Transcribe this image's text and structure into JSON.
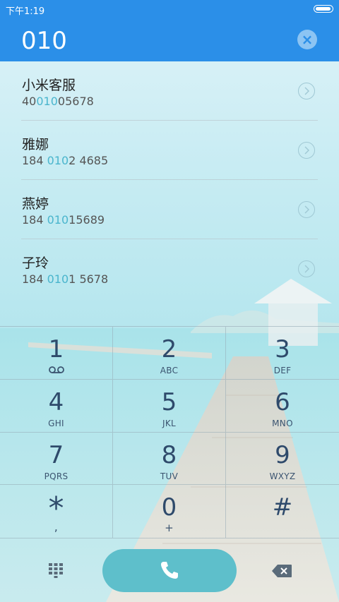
{
  "status_bar": {
    "time": "下午1:19",
    "battery_level": 0.95
  },
  "header": {
    "dialed_number": "010",
    "clear_icon": "close-icon"
  },
  "results": [
    {
      "name": "小米客服",
      "number_parts": [
        "40",
        "010",
        "05678"
      ]
    },
    {
      "name": "雅娜",
      "number_parts": [
        "184 ",
        "010",
        "2 4685"
      ]
    },
    {
      "name": "燕婷",
      "number_parts": [
        "184 ",
        "010",
        "15689"
      ]
    },
    {
      "name": "子玲",
      "number_parts": [
        "184 ",
        "010",
        "1 5678"
      ]
    }
  ],
  "keypad": [
    {
      "digit": "1",
      "letters": "",
      "icon": "voicemail-icon"
    },
    {
      "digit": "2",
      "letters": "ABC"
    },
    {
      "digit": "3",
      "letters": "DEF"
    },
    {
      "digit": "4",
      "letters": "GHI"
    },
    {
      "digit": "5",
      "letters": "JKL"
    },
    {
      "digit": "6",
      "letters": "MNO"
    },
    {
      "digit": "7",
      "letters": "PQRS"
    },
    {
      "digit": "8",
      "letters": "TUV"
    },
    {
      "digit": "9",
      "letters": "WXYZ"
    },
    {
      "digit": "*",
      "letters": ","
    },
    {
      "digit": "0",
      "letters": "+"
    },
    {
      "digit": "#",
      "letters": ""
    }
  ],
  "bottom_bar": {
    "keypad_icon": "dialpad-icon",
    "call_icon": "phone-icon",
    "backspace_icon": "backspace-icon"
  },
  "colors": {
    "header": "#2b8fe8",
    "highlight": "#4ab5cd",
    "call_button": "#5ebfcb",
    "key_text": "#2e4a6b"
  }
}
